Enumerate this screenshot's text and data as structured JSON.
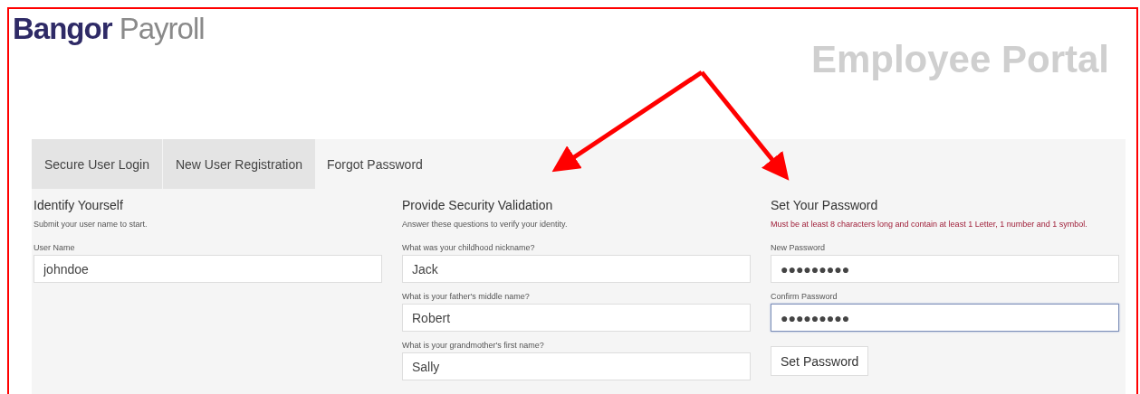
{
  "logo": {
    "bold": "Bangor",
    "light": "Payroll"
  },
  "portal_title": "Employee Portal",
  "tabs": [
    {
      "label": "Secure User Login",
      "selected": false
    },
    {
      "label": "New User Registration",
      "selected": false
    },
    {
      "label": "Forgot Password",
      "selected": true
    }
  ],
  "sections": [
    {
      "title": "Identify Yourself",
      "description": "Submit your user name to start.",
      "kind": "normal",
      "fields": [
        {
          "label": "User Name",
          "value": "johndoe",
          "focused": false
        }
      ]
    },
    {
      "title": "Provide Security Validation",
      "description": "Answer these questions to verify your identity.",
      "kind": "normal",
      "fields": [
        {
          "label": "What was your childhood nickname?",
          "value": "Jack",
          "focused": false
        },
        {
          "label": "What is your father's middle name?",
          "value": "Robert",
          "focused": false
        },
        {
          "label": "What is your grandmother's first name?",
          "value": "Sally",
          "focused": false
        }
      ]
    },
    {
      "title": "Set Your Password",
      "description": "Must be at least 8 characters long and contain at least 1 Letter, 1 number and 1 symbol.",
      "kind": "warning",
      "fields": [
        {
          "label": "New Password",
          "value": "●●●●●●●●●",
          "focused": false
        },
        {
          "label": "Confirm Password",
          "value": "●●●●●●●●●",
          "focused": true
        }
      ],
      "button": "Set Password"
    }
  ]
}
